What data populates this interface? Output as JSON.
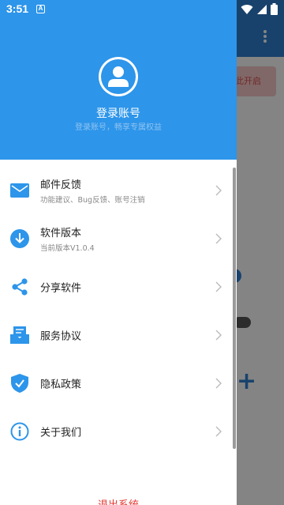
{
  "status_bar": {
    "time": "3:51",
    "notification_letter": "A",
    "icons": [
      "wifi-icon",
      "signal-icon",
      "battery-icon"
    ]
  },
  "background_app": {
    "chip_label": "此开启",
    "accent_color": "#2f7fd0"
  },
  "drawer": {
    "header": {
      "title": "登录账号",
      "subtitle": "登录账号，畅享专属权益"
    },
    "items": [
      {
        "label": "邮件反馈",
        "sub": "功能建议、Bug反馈、账号注销",
        "icon": "mail-icon"
      },
      {
        "label": "软件版本",
        "sub": "当前版本V1.0.4",
        "icon": "download-icon"
      },
      {
        "label": "分享软件",
        "sub": "",
        "icon": "share-icon"
      },
      {
        "label": "服务协议",
        "sub": "",
        "icon": "agreement-icon"
      },
      {
        "label": "隐私政策",
        "sub": "",
        "icon": "shield-icon"
      },
      {
        "label": "关于我们",
        "sub": "",
        "icon": "info-icon"
      }
    ],
    "logout_label": "退出系统",
    "colors": {
      "header": "#2d95ea",
      "icon": "#2d95ea",
      "logout": "#e53935"
    }
  }
}
